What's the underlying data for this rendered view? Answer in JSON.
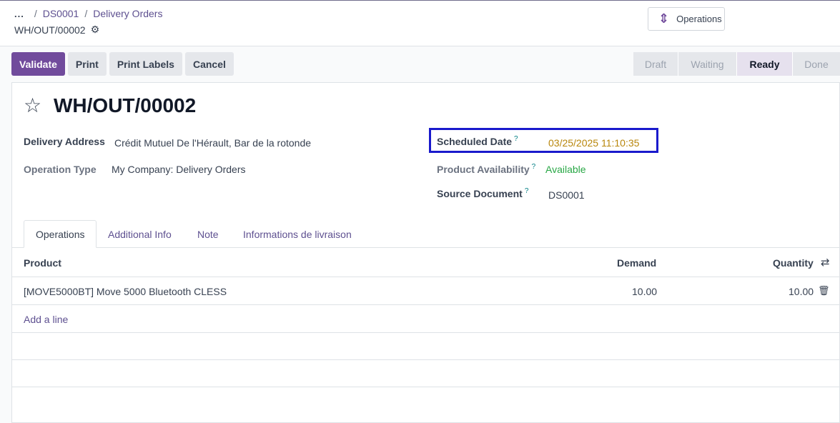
{
  "breadcrumb": {
    "dots": "...",
    "link1": "DS0001",
    "link2": "Delivery Orders"
  },
  "record_id": "WH/OUT/00002",
  "operations_button": "Operations",
  "buttons": {
    "validate": "Validate",
    "print": "Print",
    "print_labels": "Print Labels",
    "cancel": "Cancel"
  },
  "status": {
    "draft": "Draft",
    "waiting": "Waiting",
    "ready": "Ready",
    "done": "Done",
    "current": "Ready"
  },
  "form": {
    "title": "WH/OUT/00002",
    "delivery_address_label": "Delivery Address",
    "delivery_address_value": "Crédit Mutuel De l'Hérault, Bar de la rotonde",
    "operation_type_label": "Operation Type",
    "operation_type_value": "My Company: Delivery Orders",
    "scheduled_date_label": "Scheduled Date",
    "scheduled_date_value": "03/25/2025 11:10:35",
    "availability_label": "Product Availability",
    "availability_value": "Available",
    "source_document_label": "Source Document",
    "source_document_value": "DS0001",
    "help_mark": "?"
  },
  "tabs": {
    "operations": "Operations",
    "additional_info": "Additional Info",
    "note": "Note",
    "livraison": "Informations de livraison"
  },
  "table": {
    "headers": {
      "product": "Product",
      "demand": "Demand",
      "quantity": "Quantity"
    },
    "rows": [
      {
        "product": "[MOVE5000BT] Move 5000 Bluetooth CLESS",
        "demand": "10.00",
        "quantity": "10.00"
      }
    ],
    "add_line": "Add a line"
  },
  "colors": {
    "primary": "#714b9c",
    "highlight": "#1a1acc",
    "available": "#28a745",
    "date": "#b8860b"
  }
}
